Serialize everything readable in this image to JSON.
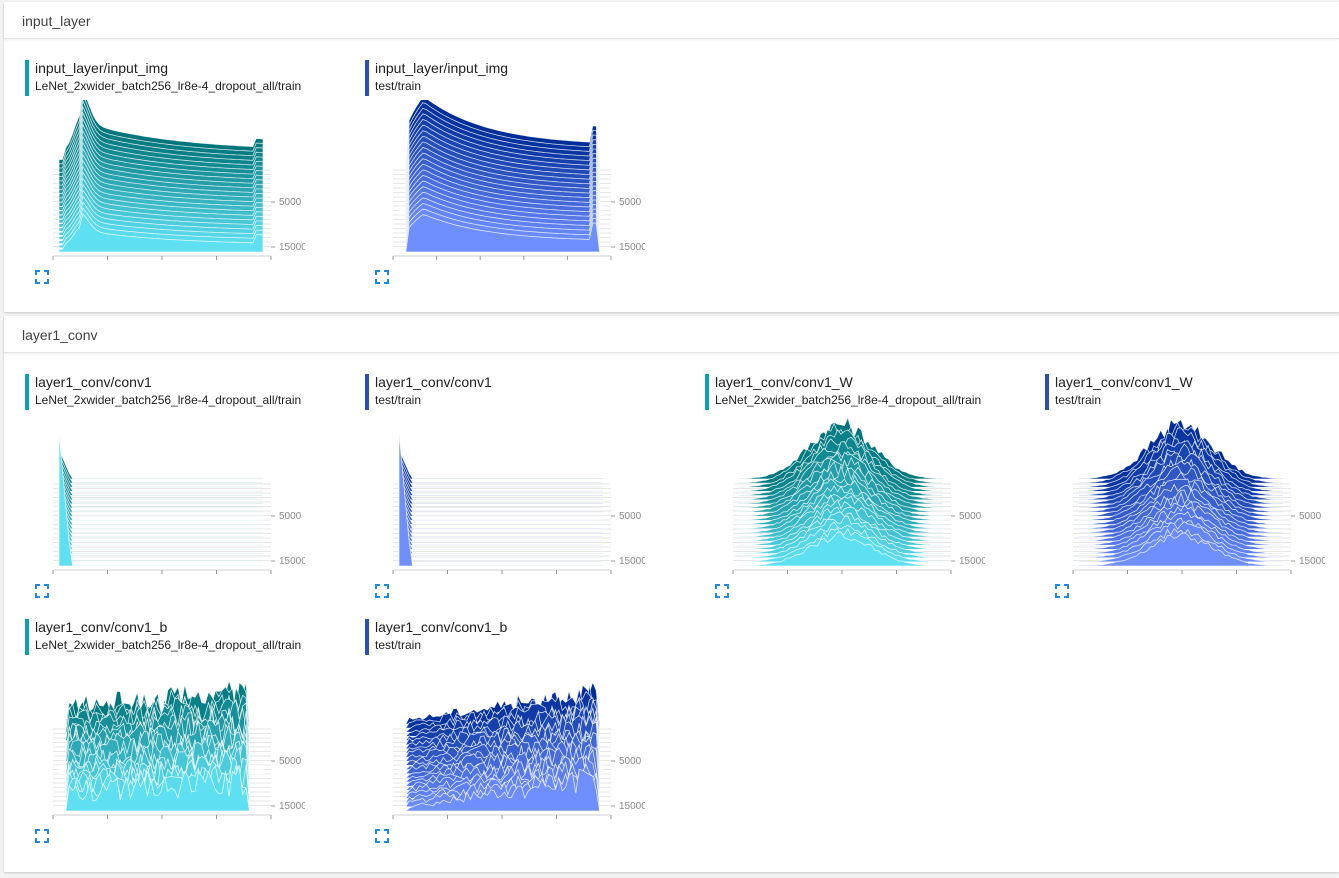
{
  "colors": {
    "teal_dark": "#00767c",
    "teal_light": "#5fe0f2",
    "blue_dark": "#002d98",
    "blue_light": "#6f8fff",
    "expand_icon": "#1e88e5"
  },
  "sections": [
    {
      "name": "input_layer",
      "cards": [
        {
          "tag": "input_layer/input_img",
          "run": "LeNet_2xwider_batch256_lr8e-4_dropout_all/train",
          "color": "teal",
          "x_ticks": [
            "0.1",
            "0.3",
            "0.5",
            "0.7",
            "0.9"
          ],
          "y_ticks": [
            "5000",
            "15000"
          ],
          "shape": "input_teal"
        },
        {
          "tag": "input_layer/input_img",
          "run": "test/train",
          "color": "blue",
          "x_ticks": [
            "-0.5",
            "-0.3",
            "-0.1",
            "0.1",
            "0.3",
            "0.5"
          ],
          "y_ticks": [
            "5000",
            "15000"
          ],
          "shape": "input_blue"
        }
      ]
    },
    {
      "name": "layer1_conv",
      "cards": [
        {
          "tag": "layer1_conv/conv1",
          "run": "LeNet_2xwider_batch256_lr8e-4_dropout_all/train",
          "color": "teal",
          "x_ticks": [
            "0.0",
            "1.0",
            "2.0",
            "3.0",
            "4.0"
          ],
          "y_ticks": [
            "5000",
            "15000"
          ],
          "shape": "spike"
        },
        {
          "tag": "layer1_conv/conv1",
          "run": "test/train",
          "color": "blue",
          "x_ticks": [
            "0.0",
            "1.0",
            "2.0",
            "3.0",
            "4.0"
          ],
          "y_ticks": [
            "5000",
            "15000"
          ],
          "shape": "spike"
        },
        {
          "tag": "layer1_conv/conv1_W",
          "run": "LeNet_2xwider_batch256_lr8e-4_dropout_all/train",
          "color": "teal",
          "x_ticks": [
            "-0.4",
            "-0.2",
            "0.0",
            "0.2",
            "0.4"
          ],
          "y_ticks": [
            "5000",
            "15000"
          ],
          "shape": "bell"
        },
        {
          "tag": "layer1_conv/conv1_W",
          "run": "test/train",
          "color": "blue",
          "x_ticks": [
            "-0.4",
            "-0.2",
            "0.0",
            "0.2",
            "0.4"
          ],
          "y_ticks": [
            "5000",
            "15000"
          ],
          "shape": "bell"
        },
        {
          "tag": "layer1_conv/conv1_b",
          "run": "LeNet_2xwider_batch256_lr8e-4_dropout_all/train",
          "color": "teal",
          "x_ticks": [
            "-0.02",
            "0.02",
            "0.06",
            "0.10",
            "0.14"
          ],
          "y_ticks": [
            "5000",
            "15000"
          ],
          "shape": "jagged_teal"
        },
        {
          "tag": "layer1_conv/conv1_b",
          "run": "test/train",
          "color": "blue",
          "x_ticks": [
            "-0.06",
            "-0.02",
            "0.02",
            "0.06",
            "0.10"
          ],
          "y_ticks": [
            "5000",
            "15000"
          ],
          "shape": "jagged_blue"
        }
      ]
    }
  ]
}
